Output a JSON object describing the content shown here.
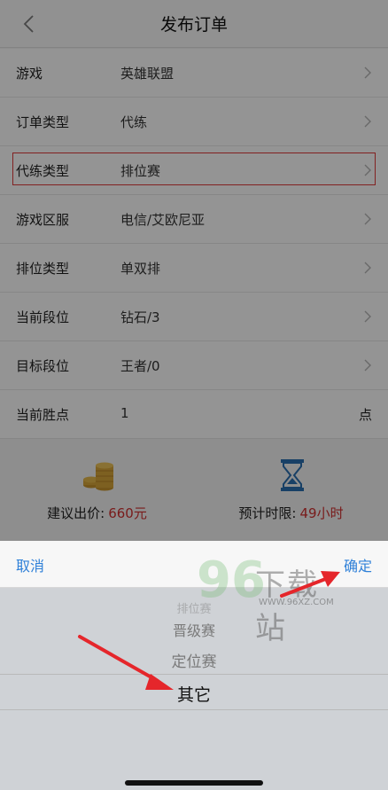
{
  "header": {
    "title": "发布订单"
  },
  "form": {
    "rows": [
      {
        "label": "游戏",
        "value": "英雄联盟"
      },
      {
        "label": "订单类型",
        "value": "代练"
      },
      {
        "label": "代练类型",
        "value": "排位赛"
      },
      {
        "label": "游戏区服",
        "value": "电信/艾欧尼亚"
      },
      {
        "label": "排位类型",
        "value": "单双排"
      },
      {
        "label": "当前段位",
        "value": "钻石/3"
      },
      {
        "label": "目标段位",
        "value": "王者/0"
      },
      {
        "label": "当前胜点",
        "value": "1",
        "unit": "点"
      }
    ]
  },
  "summary": {
    "price_label": "建议出价:",
    "price_value": "660元",
    "time_label": "预计时限:",
    "time_value": "49小时"
  },
  "sheet": {
    "cancel_label": "取消",
    "confirm_label": "确定",
    "options": [
      "排位赛",
      "晋级赛",
      "定位赛",
      "其它"
    ],
    "selected": "其它"
  },
  "watermark": {
    "number": "96",
    "text": "下载站",
    "url": "WWW.96XZ.COM"
  },
  "colors": {
    "accent": "#2f80d8",
    "price": "#d03030",
    "highlight_box": "#e03a3a",
    "arrow": "#e5262b",
    "coin": "#d8a53a",
    "hourglass": "#2a6fb0"
  }
}
